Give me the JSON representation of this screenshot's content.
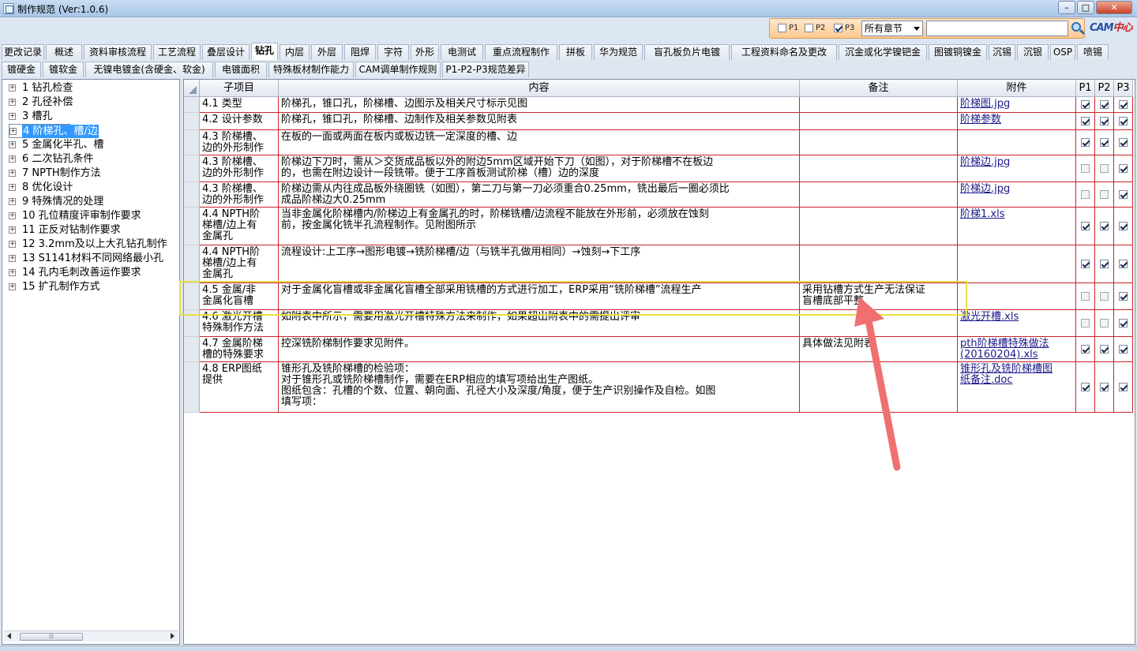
{
  "window": {
    "title": "制作规范 (Ver:1.0.6)",
    "buttons": [
      "–",
      "□",
      "✕"
    ]
  },
  "filters": {
    "p1_label": "P1",
    "p1_checked": false,
    "p2_label": "P2",
    "p2_checked": false,
    "p3_label": "P3",
    "p3_checked": true,
    "chapter_select": "所有章节",
    "search_value": ""
  },
  "logo": {
    "text_a": "CAM",
    "text_b": "中心"
  },
  "tabs_row1": [
    "更改记录",
    "概述",
    "资料审核流程",
    "工艺流程",
    "叠层设计",
    "钻孔",
    "内层",
    "外层",
    "阻焊",
    "字符",
    "外形",
    "电测试",
    "重点流程制作",
    "拼板",
    "华为规范",
    "盲孔板负片电镀",
    "工程资料命名及更改",
    "沉金或化学镍钯金",
    "图镀铜镍金",
    "沉锡",
    "沉银",
    "OSP",
    "喷锡"
  ],
  "tabs_row2": [
    "镀硬金",
    "镀软金",
    "无镍电镀金(含硬金、软金)",
    "电镀面积",
    "特殊板材制作能力",
    "CAM调单制作规则",
    "P1-P2-P3规范差异"
  ],
  "active_tab": "钻孔",
  "tree": [
    "1 钻孔检查",
    "2 孔径补偿",
    "3 槽孔",
    "4 阶梯孔、槽/边",
    "5 金属化半孔、槽",
    "6 二次钻孔条件",
    "7 NPTH制作方法",
    "8 优化设计",
    "9 特殊情况的处理",
    "10 孔位精度评审制作要求",
    "11 正反对钻制作要求",
    "12 3.2mm及以上大孔钻孔制作",
    "13 S1141材料不同网络最小孔",
    "14 孔内毛刺改善运作要求",
    "15 扩孔制作方式"
  ],
  "selected_tree_index": 3,
  "columns": [
    "子项目",
    "内容",
    "备注",
    "附件",
    "P1",
    "P2",
    "P3"
  ],
  "rows": [
    {
      "sub": "4.1 类型",
      "content": "阶梯孔，锥口孔，阶梯槽、边图示及相关尺寸标示见图",
      "note": "",
      "attach": "阶梯图.jpg",
      "p1": true,
      "p2": true,
      "p3": true
    },
    {
      "sub": "4.2 设计参数",
      "content": "阶梯孔，锥口孔，阶梯槽、边制作及相关参数见附表",
      "note": "",
      "attach": "阶梯参数",
      "p1": true,
      "p2": true,
      "p3": true
    },
    {
      "sub": "4.3 阶梯槽、\n边的外形制作",
      "content": "在板的一面或两面在板内或板边铣一定深度的槽、边",
      "note": "",
      "attach": "",
      "p1": true,
      "p2": true,
      "p3": true
    },
    {
      "sub": "4.3 阶梯槽、\n边的外形制作",
      "content": "阶梯边下刀时，需从＞交货成品板以外的附边5mm区域开始下刀（如图），对于阶梯槽不在板边\n的，也需在附边设计一段铣带。便于工序首板测试阶梯（槽）边的深度",
      "note": "",
      "attach": "阶梯边.jpg",
      "p1": false,
      "p2": false,
      "p3": true
    },
    {
      "sub": "4.3 阶梯槽、\n边的外形制作",
      "content": "阶梯边需从内往成品板外绕圈铣（如图），第二刀与第一刀必须重合0.25mm，铣出最后一圈必须比\n成品阶梯边大0.25mm",
      "note": "",
      "attach": "阶梯边.jpg",
      "p1": false,
      "p2": false,
      "p3": true
    },
    {
      "sub": "4.4 NPTH阶\n梯槽/边上有\n金属孔",
      "content": "当非金属化阶梯槽内/阶梯边上有金属孔的时，阶梯铣槽/边流程不能放在外形前，必须放在蚀刻\n前，按金属化铣半孔流程制作。见附图所示",
      "note": "",
      "attach": "阶梯1.xls",
      "p1": true,
      "p2": true,
      "p3": true
    },
    {
      "sub": "4.4 NPTH阶\n梯槽/边上有\n金属孔",
      "content": "流程设计:上工序→图形电镀→铣阶梯槽/边（与铣半孔做用相同）→蚀刻→下工序",
      "note": "",
      "attach": "",
      "p1": true,
      "p2": true,
      "p3": true
    },
    {
      "sub": "4.5 金属/非\n金属化盲槽",
      "content": "对于金属化盲槽或非金属化盲槽全部采用铣槽的方式进行加工，ERP采用“铣阶梯槽”流程生产",
      "note": "采用钻槽方式生产无法保证\n盲槽底部平整",
      "attach": "",
      "p1": false,
      "p2": false,
      "p3": true
    },
    {
      "sub": "4.6 激光开槽\n特殊制作方法",
      "content": "如附表中所示，需要用激光开槽特殊方法来制作，如果超出附表中的需提出评审",
      "note": "",
      "attach": "激光开槽.xls",
      "p1": false,
      "p2": false,
      "p3": true
    },
    {
      "sub": "4.7 金属阶梯\n槽的特殊要求",
      "content": "控深铣阶梯制作要求见附件。",
      "note": "具体做法见附表",
      "attach": "pth阶梯槽特殊做法\n(20160204).xls",
      "p1": true,
      "p2": true,
      "p3": true
    },
    {
      "sub": "4.8 ERP图纸\n提供",
      "content": "锥形孔及铣阶梯槽的检验项：\n对于锥形孔或铣阶梯槽制作，需要在ERP相应的填写项给出生产图纸。\n图纸包含：孔槽的个数、位置、朝向面、孔径大小及深度/角度，便于生产识别操作及自检。如图\n填写项：",
      "note": "",
      "attach": "锥形孔及铣阶梯槽图\n纸备注.doc",
      "p1": true,
      "p2": true,
      "p3": true
    }
  ],
  "annotation_color": "#f07070"
}
